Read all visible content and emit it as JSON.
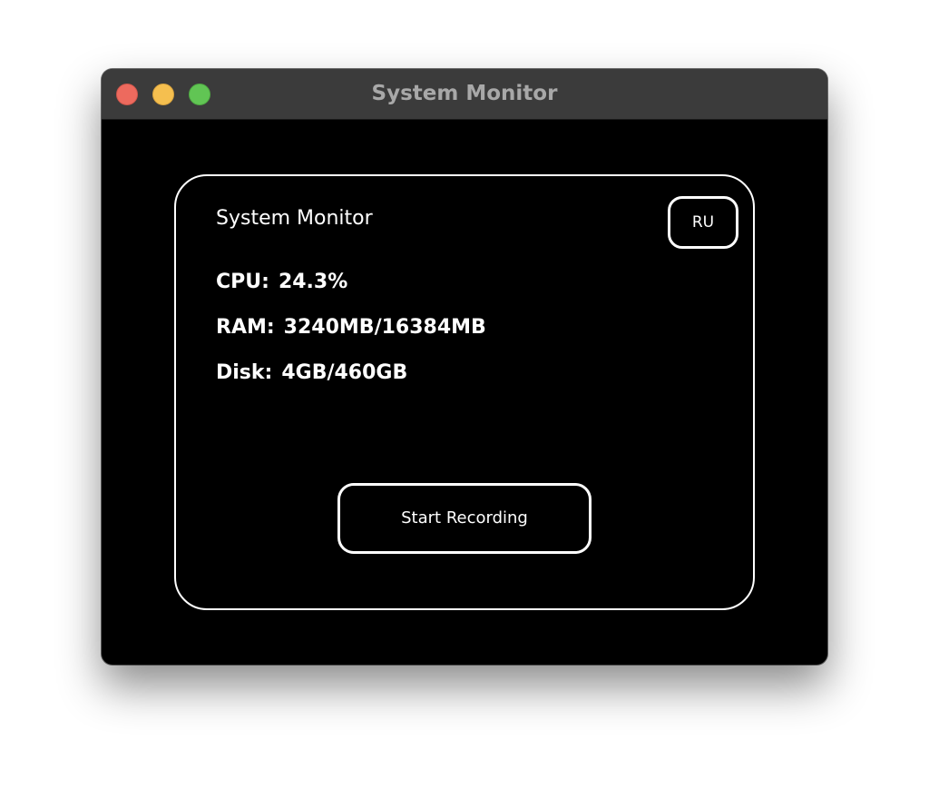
{
  "window": {
    "title": "System Monitor"
  },
  "panel": {
    "title": "System Monitor",
    "language_button": "RU",
    "stats": {
      "cpu_label": "CPU:",
      "cpu_value": "24.3%",
      "ram_label": "RAM:",
      "ram_value": "3240MB/16384MB",
      "disk_label": "Disk:",
      "disk_value": "4GB/460GB"
    },
    "record_button": "Start Recording"
  },
  "colors": {
    "background": "#000000",
    "titlebar": "#3b3b3b",
    "foreground": "#ffffff",
    "close": "#ed6a5e",
    "minimize": "#f5bf4f",
    "zoom": "#61c554"
  }
}
